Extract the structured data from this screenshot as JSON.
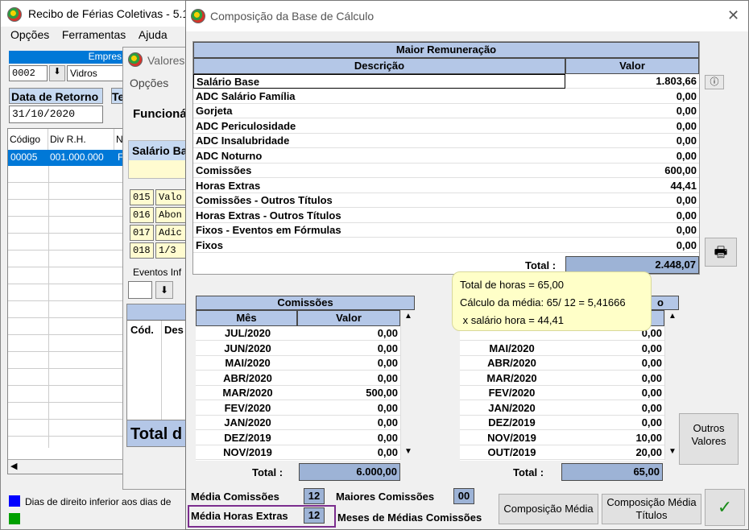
{
  "main_window": {
    "title": "Recibo de Férias Coletivas - 5.1",
    "menu": [
      "Opções",
      "Ferramentas",
      "Ajuda"
    ],
    "empresa_label": "Empres",
    "empresa_code": "0002",
    "empresa_name": "Vidros",
    "data_retorno_label": "Data de Retorno",
    "data_retorno_value": "31/10/2020",
    "te_label": "Te",
    "grid_headers": [
      "Código",
      "Div R.H.",
      "N"
    ],
    "grid_row": [
      "00005",
      "001.000.000",
      "F"
    ],
    "legend_text": "Dias de direito inferior aos dias de",
    "colors": {
      "legend_blue": "#0000ff",
      "legend_green": "#00a000"
    }
  },
  "valores_window": {
    "title": "Valores",
    "menu": "Opções",
    "funcionario_label": "Funcionár",
    "salario_label": "Salário Ba",
    "rows": [
      {
        "code": "015",
        "desc": "Valo"
      },
      {
        "code": "016",
        "desc": "Abon"
      },
      {
        "code": "017",
        "desc": "Adic"
      },
      {
        "code": "018",
        "desc": "1/3"
      }
    ],
    "eventos_label": "Eventos Inf",
    "cod_label": "Cód.",
    "desc_label": "Des",
    "total_label": "Total d"
  },
  "dialog": {
    "title": "Composição da Base de Cálculo",
    "maior_remuneracao": {
      "title": "Maior Remuneração",
      "col_desc": "Descrição",
      "col_valor": "Valor",
      "rows": [
        {
          "desc": "Salário Base",
          "valor": "1.803,66"
        },
        {
          "desc": "ADC Salário Família",
          "valor": "0,00"
        },
        {
          "desc": "Gorjeta",
          "valor": "0,00"
        },
        {
          "desc": "ADC Periculosidade",
          "valor": "0,00"
        },
        {
          "desc": "ADC Insalubridade",
          "valor": "0,00"
        },
        {
          "desc": "ADC Noturno",
          "valor": "0,00"
        },
        {
          "desc": "Comissões",
          "valor": "600,00"
        },
        {
          "desc": "Horas Extras",
          "valor": "44,41"
        },
        {
          "desc": "Comissões - Outros Títulos",
          "valor": "0,00"
        },
        {
          "desc": "Horas Extras - Outros Títulos",
          "valor": "0,00"
        },
        {
          "desc": "Fixos - Eventos em Fórmulas",
          "valor": "0,00"
        },
        {
          "desc": "Fixos",
          "valor": "0,00"
        }
      ],
      "total_label": "Total :",
      "total_value": "2.448,07"
    },
    "comissoes": {
      "title": "Comissões",
      "col_mes": "Mês",
      "col_valor": "Valor",
      "rows": [
        {
          "mes": "JUL/2020",
          "valor": "0,00"
        },
        {
          "mes": "JUN/2020",
          "valor": "0,00"
        },
        {
          "mes": "MAI/2020",
          "valor": "0,00"
        },
        {
          "mes": "ABR/2020",
          "valor": "0,00"
        },
        {
          "mes": "MAR/2020",
          "valor": "500,00"
        },
        {
          "mes": "FEV/2020",
          "valor": "0,00"
        },
        {
          "mes": "JAN/2020",
          "valor": "0,00"
        },
        {
          "mes": "DEZ/2019",
          "valor": "0,00"
        },
        {
          "mes": "NOV/2019",
          "valor": "0,00"
        }
      ],
      "total_label": "Total :",
      "total_value": "6.000,00"
    },
    "horas": {
      "title": "o",
      "rows": [
        {
          "mes": "",
          "valor": "0,00"
        },
        {
          "mes": "MAI/2020",
          "valor": "0,00"
        },
        {
          "mes": "ABR/2020",
          "valor": "0,00"
        },
        {
          "mes": "MAR/2020",
          "valor": "0,00"
        },
        {
          "mes": "FEV/2020",
          "valor": "0,00"
        },
        {
          "mes": "JAN/2020",
          "valor": "0,00"
        },
        {
          "mes": "DEZ/2019",
          "valor": "0,00"
        },
        {
          "mes": "NOV/2019",
          "valor": "10,00"
        },
        {
          "mes": "OUT/2019",
          "valor": "20,00"
        }
      ],
      "total_label": "Total :",
      "total_value": "65,00"
    },
    "tooltip": {
      "line1": "Total de horas =  65,00",
      "line2": "Cálculo da média: 65/ 12 = 5,41666",
      "line3": " x salário hora = 44,41"
    },
    "outros_valores": "Outros Valores",
    "media_comissoes_label": "Média Comissões",
    "media_comissoes_value": "12",
    "maiores_comissoes_label": "Maiores Comissões",
    "maiores_comissoes_value": "00",
    "media_horas_label": "Média Horas Extras",
    "media_horas_value": "12",
    "meses_medias_label": "Meses de Médias Comissões",
    "composicao_media": "Composição Média",
    "composicao_media_titulos": "Composição Média Títulos",
    "colors": {
      "header": "#b4c7e7",
      "total": "#9db3d6",
      "highlight": "#7b2d8e",
      "ok": "#1a8c1a"
    }
  }
}
